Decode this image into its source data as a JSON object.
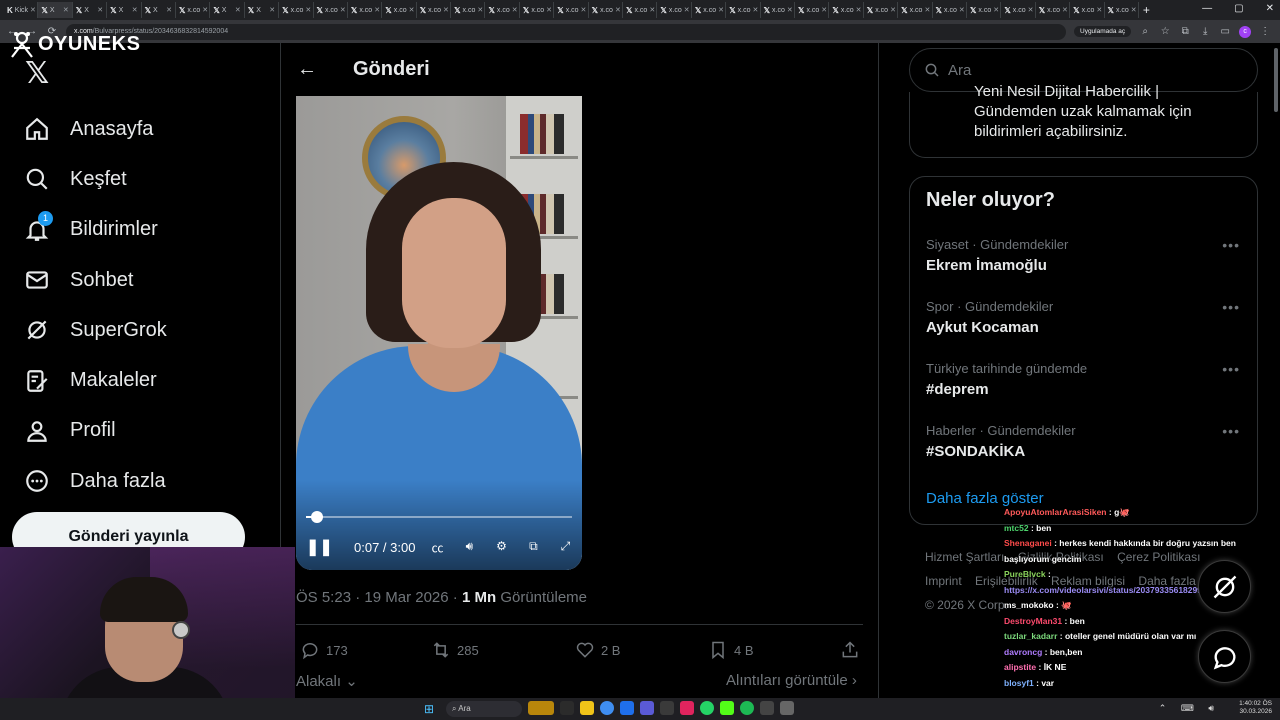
{
  "browser": {
    "tabs": [
      "Kick",
      "X",
      "X",
      "X",
      "X",
      "x.co",
      "X",
      "X",
      "x.co",
      "x.co",
      "x.co",
      "x.co",
      "x.co",
      "x.co",
      "x.co",
      "x.co",
      "x.co",
      "x.co",
      "x.co",
      "x.co",
      "x.co",
      "x.co",
      "x.co",
      "x.co",
      "x.co",
      "x.co",
      "x.co",
      "x.co",
      "x.co",
      "x.co",
      "x.co",
      "x.co",
      "x.co"
    ],
    "url_host": "x.com",
    "url_path": "/Bulvarpress/status/2034636832814592004",
    "open_in_app_label": "Uygulamada aç",
    "profile_initial": "c"
  },
  "overlay_logo": {
    "text": "OYUNEKS"
  },
  "sidebar": {
    "items": [
      {
        "label": "Anasayfa",
        "icon": "home-icon"
      },
      {
        "label": "Keşfet",
        "icon": "search-icon"
      },
      {
        "label": "Bildirimler",
        "icon": "bell-icon",
        "badge": "1"
      },
      {
        "label": "Sohbet",
        "icon": "mail-icon"
      },
      {
        "label": "SuperGrok",
        "icon": "grok-icon"
      },
      {
        "label": "Makaleler",
        "icon": "article-icon"
      },
      {
        "label": "Profil",
        "icon": "person-icon"
      },
      {
        "label": "Daha fazla",
        "icon": "more-icon"
      }
    ],
    "post_button": "Gönderi yayınla"
  },
  "main": {
    "title": "Gönderi",
    "video": {
      "time": "0:07 / 3:00",
      "progress": 0.04
    },
    "meta": {
      "time": "ÖS 5:23",
      "date": "19 Mar 2026",
      "views_count": "1 Mn",
      "views_label": "Görüntüleme",
      "sep": "·"
    },
    "actions": {
      "replies": "173",
      "reposts": "285",
      "likes": "2 B",
      "bookmarks": "4 B"
    },
    "related": "Alakalı",
    "quotes": "Alıntıları görüntüle"
  },
  "right": {
    "search_placeholder": "Ara",
    "subscribe_text": "Yeni Nesil Dijital Habercilik | Gündemden uzak kalmamak için bildirimleri açabilirsiniz.",
    "trends_title": "Neler oluyor?",
    "trends": [
      {
        "category": "Siyaset · Gündemdekiler",
        "name": "Ekrem İmamoğlu"
      },
      {
        "category": "Spor · Gündemdekiler",
        "name": "Aykut Kocaman"
      },
      {
        "category": "Türkiye tarihinde gündemde",
        "name": "#deprem"
      },
      {
        "category": "Haberler · Gündemdekiler",
        "name": "#SONDAKİKA"
      }
    ],
    "show_more": "Daha fazla göster",
    "footer_row1": [
      "Hizmet Şartları",
      "Gizlilik Politikası",
      "Çerez Politikası"
    ],
    "footer_row2": [
      "Imprint",
      "Erişilebilirlik",
      "Reklam bilgisi",
      "Daha fazla"
    ],
    "copyright": "© 2026 X Corp."
  },
  "chat": [
    {
      "user": "ApoyuAtomlarArasiSiken",
      "color": "#ff5a5a",
      "text": ": g🐙"
    },
    {
      "user": "mtc52",
      "color": "#4dd36c",
      "text": ": ben"
    },
    {
      "user": "Shenaganei",
      "color": "#ff4b4b",
      "text": ": herkes kendi hakkında bir doğru yazsın ben başlıyorum gencim"
    },
    {
      "user": "PureBlvck",
      "color": "#8ad35c",
      "text": ":"
    },
    {
      "user": "",
      "color": "#9b8cf5",
      "text": "https://x.com/videolarsivi/status/2037933561829994418?s=46"
    },
    {
      "user": "ms_mokoko",
      "color": "#ffffff",
      "text": ": 🐙"
    },
    {
      "user": "DestroyMan31",
      "color": "#ff4b6e",
      "text": ": ben"
    },
    {
      "user": "tuzlar_kadarr",
      "color": "#7cd97c",
      "text": ": oteller genel müdürü olan var mı"
    },
    {
      "user": "davroncg",
      "color": "#b07cff",
      "text": ": ben,ben"
    },
    {
      "user": "alipstite",
      "color": "#ff6fb0",
      "text": ": İK NE"
    },
    {
      "user": "blosyf1",
      "color": "#7fb2ff",
      "text": ": var"
    }
  ],
  "taskbar": {
    "search": "Ara",
    "time": "1:40:02 ÖS",
    "date": "30.03.2026"
  },
  "colors": {
    "accent": "#1d9bf0",
    "background": "#000000",
    "border": "#2f3336",
    "muted": "#71767b"
  }
}
